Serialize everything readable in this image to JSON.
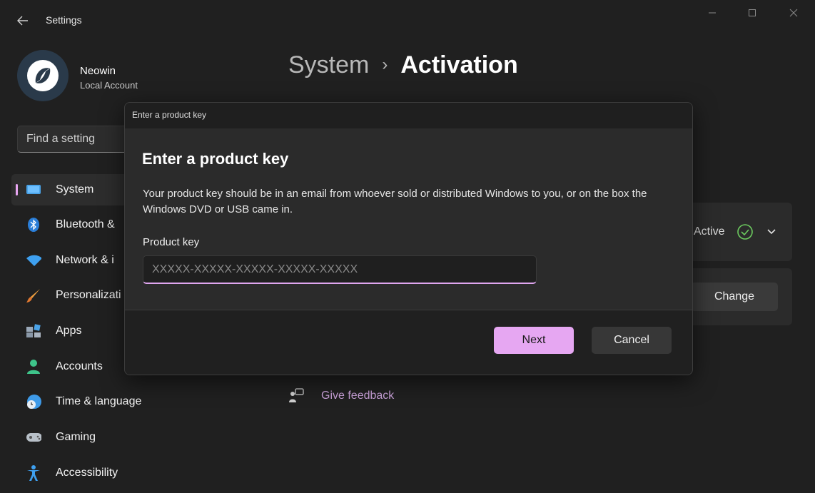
{
  "app": {
    "title": "Settings"
  },
  "user": {
    "name": "Neowin",
    "account_type": "Local Account"
  },
  "search": {
    "placeholder": "Find a setting"
  },
  "sidebar": {
    "items": [
      {
        "label": "System",
        "icon": "monitor-icon",
        "active": true
      },
      {
        "label": "Bluetooth &",
        "icon": "bluetooth-icon"
      },
      {
        "label": "Network & i",
        "icon": "wifi-icon"
      },
      {
        "label": "Personalizati",
        "icon": "brush-icon"
      },
      {
        "label": "Apps",
        "icon": "apps-icon"
      },
      {
        "label": "Accounts",
        "icon": "person-icon"
      },
      {
        "label": "Time & language",
        "icon": "globe-clock-icon"
      },
      {
        "label": "Gaming",
        "icon": "gamepad-icon"
      },
      {
        "label": "Accessibility",
        "icon": "accessibility-icon"
      }
    ]
  },
  "header": {
    "parent": "System",
    "separator": "›",
    "current": "Activation"
  },
  "activation": {
    "status": "Active",
    "change_label": "Change"
  },
  "feedback": {
    "label": "Give feedback"
  },
  "dialog": {
    "window_title": "Enter a product key",
    "heading": "Enter a product key",
    "description": "Your product key should be in an email from whoever sold or distributed Windows to you, or on the box the Windows DVD or USB came in.",
    "field_label": "Product key",
    "placeholder": "XXXXX-XXXXX-XXXXX-XXXXX-XXXXX",
    "next_label": "Next",
    "cancel_label": "Cancel"
  },
  "colors": {
    "accent": "#e6a7f2",
    "background": "#202020",
    "dialog": "#2b2b2b"
  }
}
